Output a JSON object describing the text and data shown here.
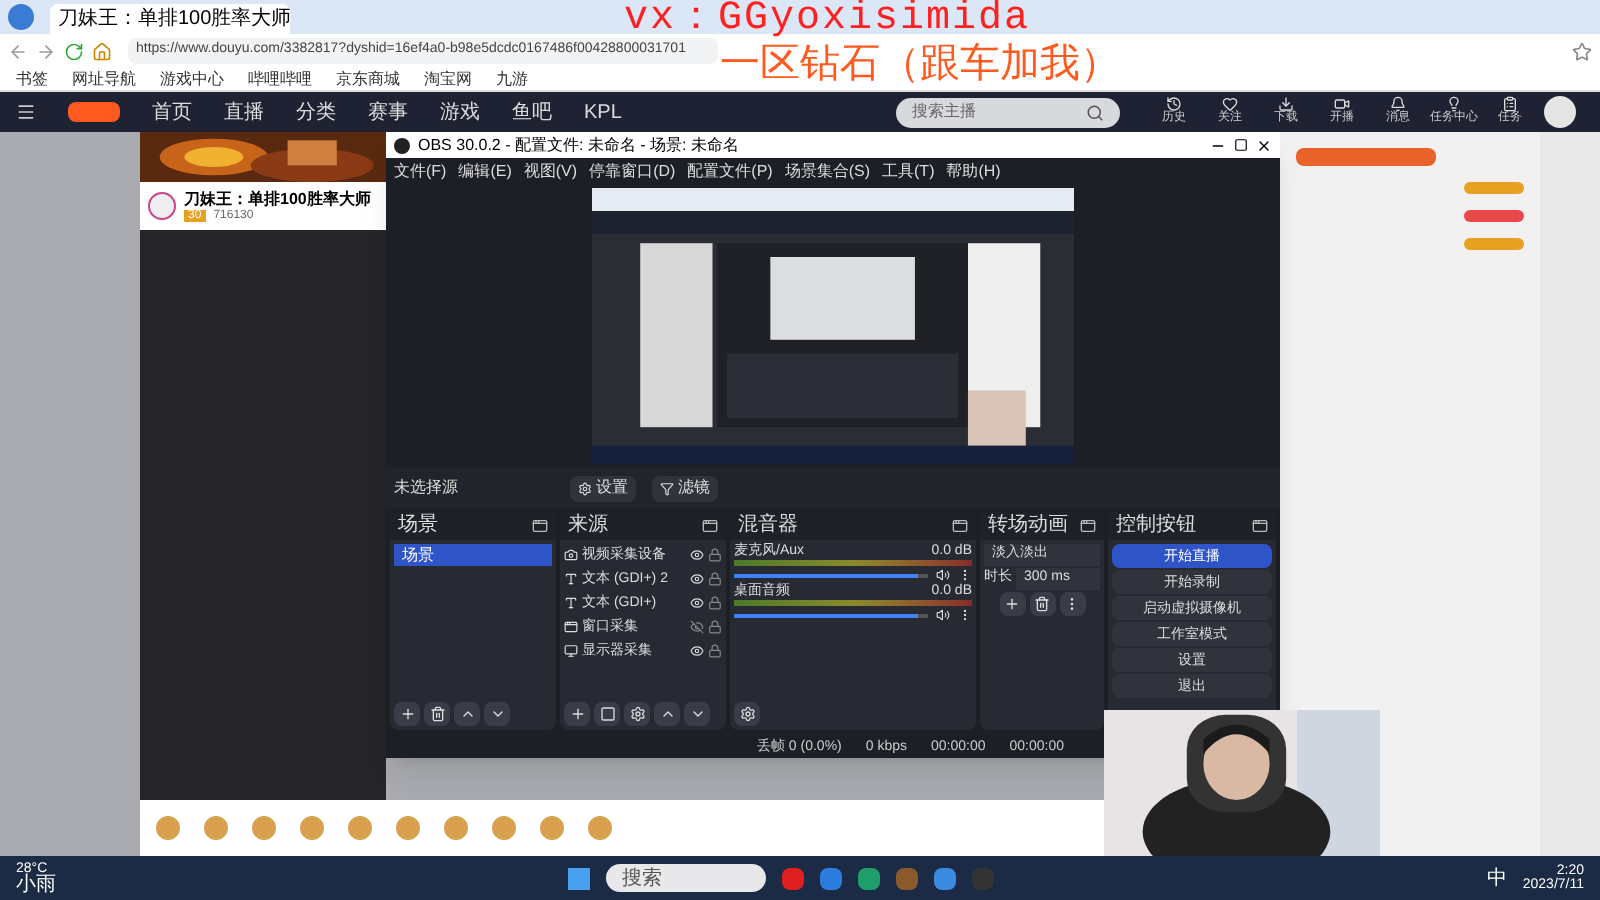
{
  "browser": {
    "tab_title": "刀妹王：单排100胜率大师",
    "url": "https://www.douyu.com/3382817?dyshid=16ef4a0-b98e5dcdc0167486f00428800031701",
    "bookmarks": [
      "书签",
      "网址导航",
      "游戏中心",
      "哔哩哔哩",
      "京东商城",
      "淘宝网",
      "九游"
    ]
  },
  "overlay": {
    "line_1": "vx：GGyoxisimida",
    "line_2": "一区钻石（跟车加我）"
  },
  "site_nav": {
    "items": [
      {
        "label": "首页",
        "selected": false
      },
      {
        "label": "直播",
        "selected": false
      },
      {
        "label": "分类",
        "selected": false
      },
      {
        "label": "赛事",
        "selected": false
      },
      {
        "label": "游戏",
        "selected": false
      },
      {
        "label": "鱼吧",
        "selected": false
      },
      {
        "label": "KPL",
        "selected": false
      }
    ],
    "search": {
      "placeholder": "搜索主播"
    },
    "icons": [
      "历史",
      "关注",
      "下载",
      "开播",
      "消息",
      "任务中心",
      "任务"
    ]
  },
  "stream": {
    "title": "刀妹王：单排100胜率大师",
    "level_badge": "30",
    "viewers": "716130"
  },
  "obs": {
    "title": "OBS 30.0.2 - 配置文件: 未命名 - 场景: 未命名",
    "menu": [
      "文件(F)",
      "编辑(E)",
      "视图(V)",
      "停靠窗口(D)",
      "配置文件(P)",
      "场景集合(S)",
      "工具(T)",
      "帮助(H)"
    ],
    "source_bar": {
      "label": "未选择源",
      "buttons": [
        "设置",
        "滤镜"
      ]
    },
    "scenes": {
      "title": "场景",
      "items": [
        {
          "label": "场景",
          "selected": true
        }
      ]
    },
    "sources": {
      "title": "来源",
      "items": [
        {
          "label": "视频采集设备",
          "kind": "camera",
          "visible": true
        },
        {
          "label": "文本 (GDI+) 2",
          "kind": "text",
          "visible": true
        },
        {
          "label": "文本 (GDI+)",
          "kind": "text",
          "visible": true
        },
        {
          "label": "窗口采集",
          "kind": "window",
          "visible": false
        },
        {
          "label": "显示器采集",
          "kind": "display",
          "visible": true
        }
      ]
    },
    "mixer": {
      "title": "混音器",
      "channels": [
        {
          "name": "麦克风/Aux",
          "reading": "0.0 dB",
          "level": 0.95
        },
        {
          "name": "桌面音频",
          "reading": "0.0 dB",
          "level": 0.95
        }
      ]
    },
    "transitions": {
      "title": "转场动画",
      "type": "淡入淡出",
      "duration_label": "时长",
      "duration": "300 ms"
    },
    "controls": {
      "title": "控制按钮",
      "buttons": [
        {
          "label": "开始直播",
          "selected": true
        },
        {
          "label": "开始录制",
          "selected": false
        },
        {
          "label": "启动虚拟摄像机",
          "selected": false
        },
        {
          "label": "工作室模式",
          "selected": false
        },
        {
          "label": "设置",
          "selected": false
        },
        {
          "label": "退出",
          "selected": false
        }
      ]
    },
    "status": [
      "丢帧 0 (0.0%)",
      "0 kbps",
      "00:00:00",
      "00:00:00"
    ]
  },
  "taskbar": {
    "weather_temp": "28°C",
    "weather": "小雨",
    "search": {
      "placeholder": "搜索"
    },
    "ime": "中",
    "time": "2:20",
    "date": "2023/7/11"
  }
}
